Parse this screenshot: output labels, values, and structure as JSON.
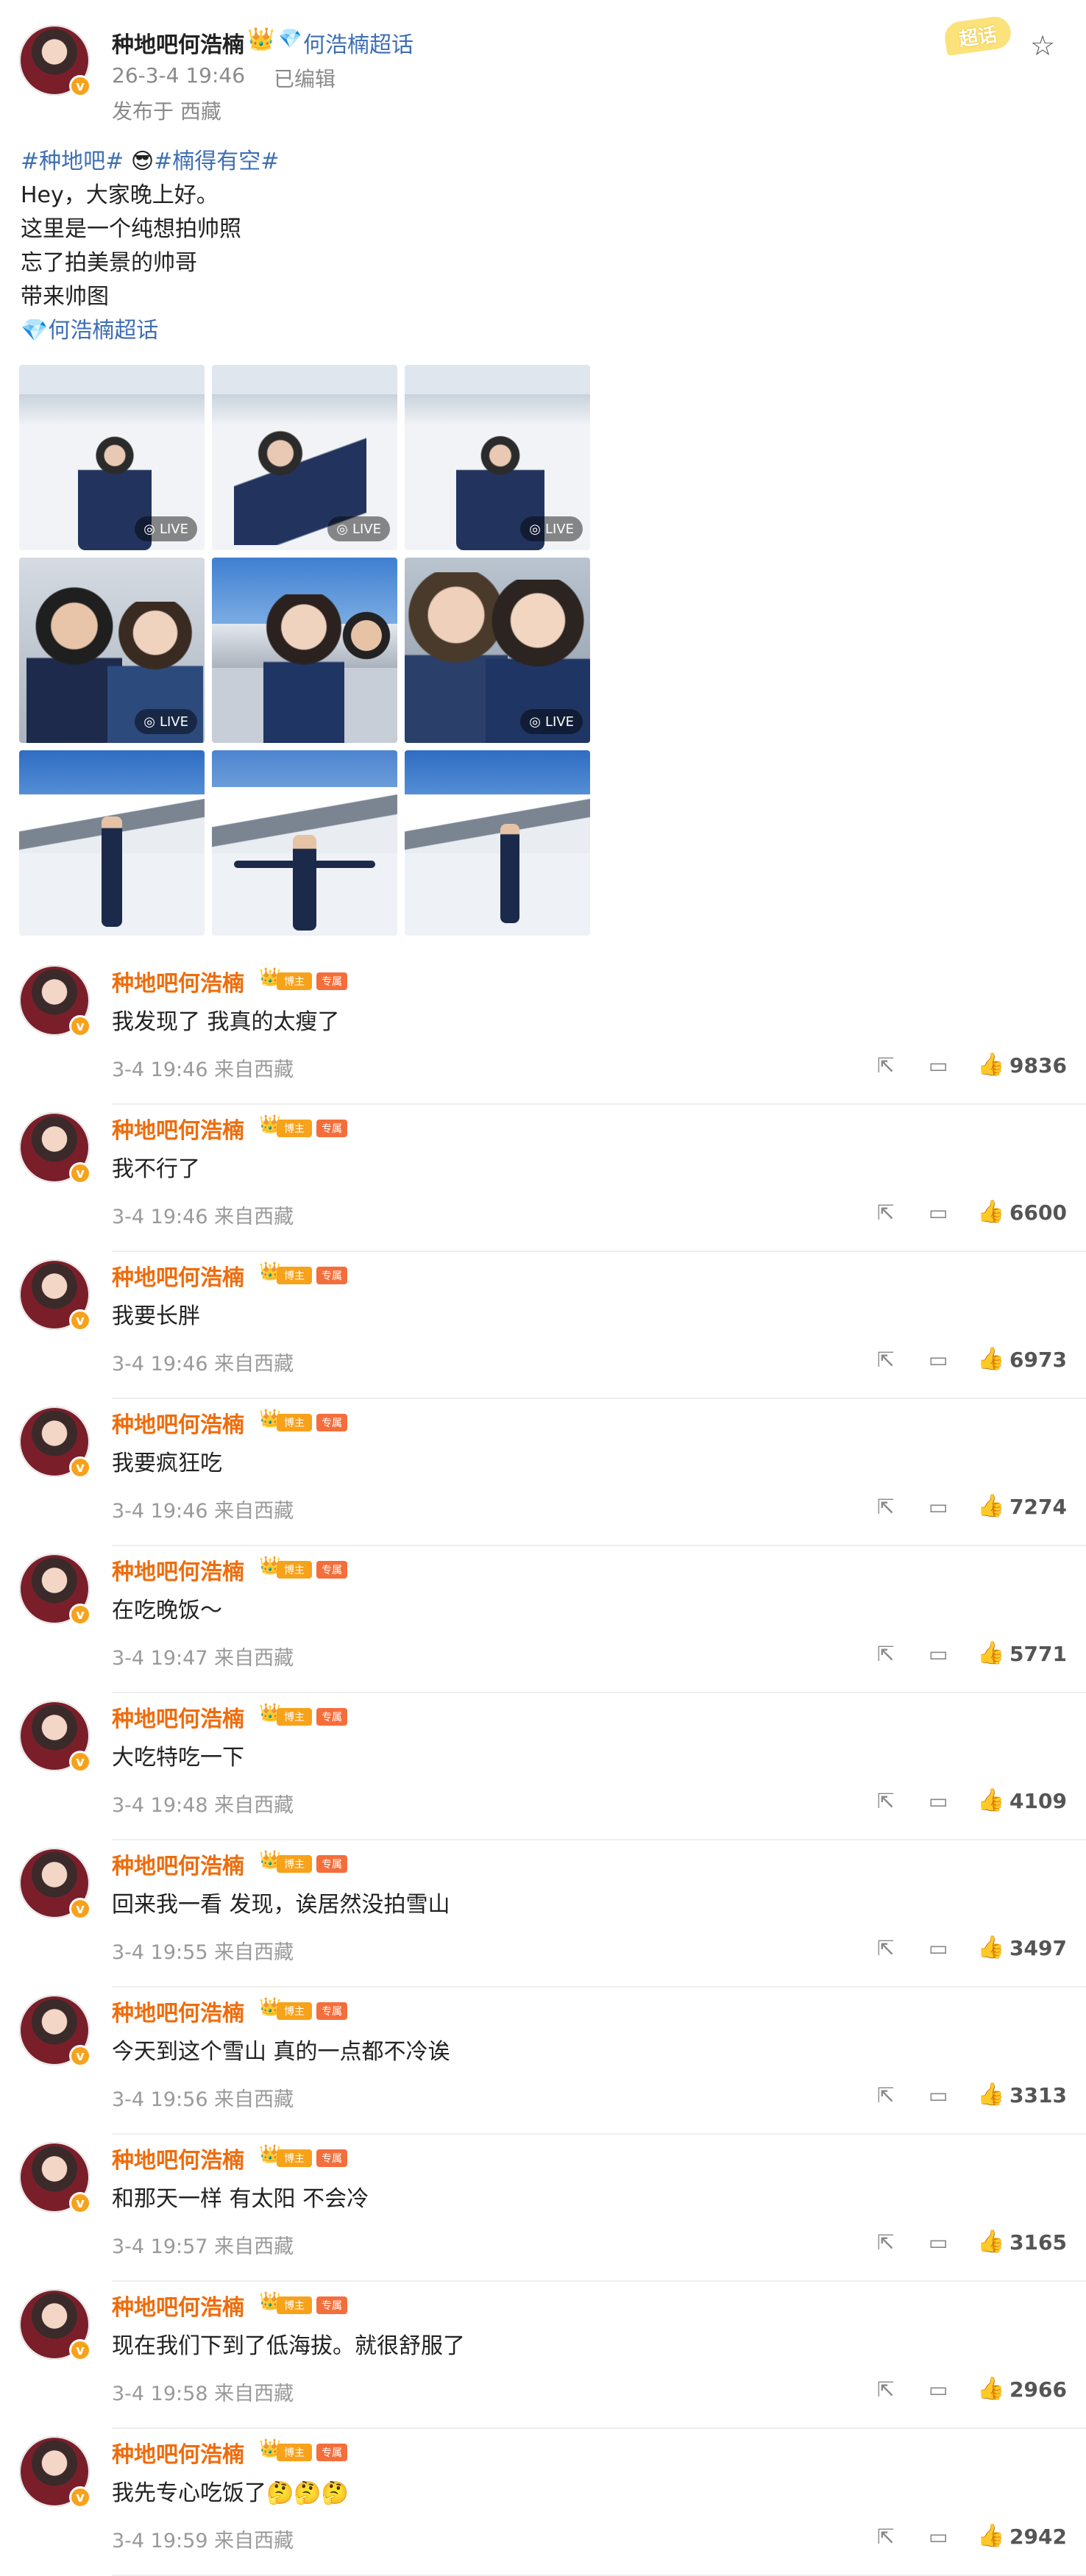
{
  "post": {
    "author": "种地吧何浩楠",
    "crown_emoji": "👑",
    "topic_icon": "💎",
    "super_topic": "何浩楠超话",
    "time": "26-3-4 19:46",
    "edited": "已编辑",
    "location": "发布于 西藏",
    "badge_label": "超话",
    "star_icon": "☆",
    "tags_line_tag1": "#种地吧#",
    "tags_line_emoji": " 😎",
    "tags_line_tag2": "#楠得有空#",
    "lines": [
      "Hey，大家晚上好。",
      "这里是一个纯想拍帅照",
      "忘了拍美景的帅哥",
      "带来帅图"
    ],
    "topic_link_icon": "💎",
    "topic_link": "何浩楠超话",
    "live_label": "LIVE"
  },
  "comments": [
    {
      "name": "种地吧何浩楠",
      "b1": "博主",
      "b2": "专属",
      "text": "我发现了  我真的太瘦了",
      "meta": "3-4 19:46  来自西藏",
      "likes": "9836"
    },
    {
      "name": "种地吧何浩楠",
      "b1": "博主",
      "b2": "专属",
      "text": "我不行了",
      "meta": "3-4 19:46  来自西藏",
      "likes": "6600"
    },
    {
      "name": "种地吧何浩楠",
      "b1": "博主",
      "b2": "专属",
      "text": "我要长胖",
      "meta": "3-4 19:46  来自西藏",
      "likes": "6973"
    },
    {
      "name": "种地吧何浩楠",
      "b1": "博主",
      "b2": "专属",
      "text": "我要疯狂吃",
      "meta": "3-4 19:46  来自西藏",
      "likes": "7274"
    },
    {
      "name": "种地吧何浩楠",
      "b1": "博主",
      "b2": "专属",
      "text": "在吃晚饭～",
      "meta": "3-4 19:47  来自西藏",
      "likes": "5771"
    },
    {
      "name": "种地吧何浩楠",
      "b1": "博主",
      "b2": "专属",
      "text": "大吃特吃一下",
      "meta": "3-4 19:48  来自西藏",
      "likes": "4109"
    },
    {
      "name": "种地吧何浩楠",
      "b1": "博主",
      "b2": "专属",
      "text": "回来我一看 发现，诶居然没拍雪山",
      "meta": "3-4 19:55  来自西藏",
      "likes": "3497"
    },
    {
      "name": "种地吧何浩楠",
      "b1": "博主",
      "b2": "专属",
      "text": "今天到这个雪山  真的一点都不冷诶",
      "meta": "3-4 19:56  来自西藏",
      "likes": "3313"
    },
    {
      "name": "种地吧何浩楠",
      "b1": "博主",
      "b2": "专属",
      "text": "和那天一样  有太阳 不会冷",
      "meta": "3-4 19:57  来自西藏",
      "likes": "3165"
    },
    {
      "name": "种地吧何浩楠",
      "b1": "博主",
      "b2": "专属",
      "text": "现在我们下到了低海拔。就很舒服了",
      "meta": "3-4 19:58  来自西藏",
      "likes": "2966"
    },
    {
      "name": "种地吧何浩楠",
      "b1": "博主",
      "b2": "专属",
      "text": "我先专心吃饭了🤔🤔🤔",
      "meta": "3-4 19:59  来自西藏",
      "likes": "2942"
    }
  ],
  "icons": {
    "share": "share-icon",
    "reply": "comment-icon",
    "like": "thumbs-up-icon",
    "verified": "v"
  }
}
